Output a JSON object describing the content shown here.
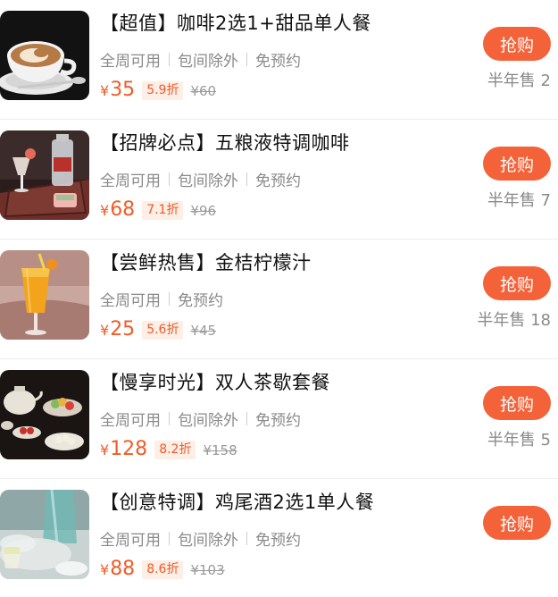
{
  "colors": {
    "accent": "#f4623a",
    "price": "#f05b28",
    "discount_bg": "#fdeee6",
    "muted": "#8a8a8a"
  },
  "currency_symbol": "¥",
  "items": [
    {
      "title": "【超值】咖啡2选1+甜品单人餐",
      "tags": [
        "全周可用",
        "包间除外",
        "免预约"
      ],
      "price": "35",
      "discount": "5.9折",
      "original_price": "¥60",
      "buy_label": "抢购",
      "sold": "半年售 2",
      "image": "latte-art-coffee-image"
    },
    {
      "title": "【招牌必点】五粮液特调咖啡",
      "tags": [
        "全周可用",
        "包间除外",
        "免预约"
      ],
      "price": "68",
      "discount": "7.1折",
      "original_price": "¥96",
      "buy_label": "抢购",
      "sold": "半年售 7",
      "image": "liquor-coffee-tray-image"
    },
    {
      "title": "【尝鲜热售】金桔柠檬汁",
      "tags": [
        "全周可用",
        "免预约"
      ],
      "price": "25",
      "discount": "5.6折",
      "original_price": "¥45",
      "buy_label": "抢购",
      "sold": "半年售 18",
      "image": "kumquat-lemon-juice-image"
    },
    {
      "title": "【慢享时光】双人茶歇套餐",
      "tags": [
        "全周可用",
        "包间除外",
        "免预约"
      ],
      "price": "128",
      "discount": "8.2折",
      "original_price": "¥158",
      "buy_label": "抢购",
      "sold": "半年售 5",
      "image": "tea-break-set-image"
    },
    {
      "title": "【创意特调】鸡尾酒2选1单人餐",
      "tags": [
        "全周可用",
        "包间除外",
        "免预约"
      ],
      "price": "88",
      "discount": "8.6折",
      "original_price": "¥103",
      "buy_label": "抢购",
      "sold": "",
      "image": "cocktail-image"
    }
  ]
}
